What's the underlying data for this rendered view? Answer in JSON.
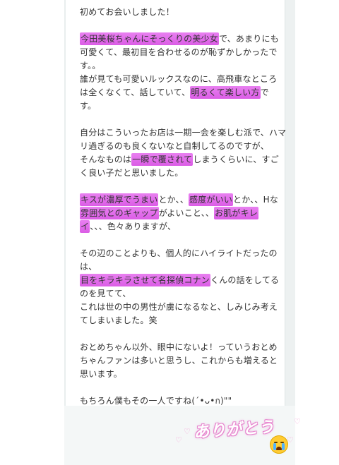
{
  "post": {
    "l01": "初めてお会いしました！",
    "l02_hl": "今田美桜ちゃんにそっくりの美少女",
    "l02_rest": "で、あまりにも",
    "l03": "可愛くて、最初目を合わせるのが恥ずかしかったで",
    "l04": "す。。",
    "l05": "誰が見ても可愛いルックスなのに、高飛車なところ",
    "l06_a": "は全くなくて、話していて、",
    "l06_hl": "明るくて楽しい方",
    "l06_b": "で",
    "l07": "す。",
    "l08": "自分はこういったお店は一期一会を楽しむ派で、ハマ",
    "l09": "リ過ぎるのも良くないなと自制してるのですが、",
    "l10_a": "そんなものは",
    "l10_hl": "一瞬で覆されて",
    "l10_b": "しまうくらいに、すご",
    "l11": "く良い子だと思いました。",
    "l12_hl1": "キスが濃厚でうまい",
    "l12_mid": "とか、、",
    "l12_hl2": "感度がいい",
    "l12_b": "とか、、Hな",
    "l13_hl": "雰囲気とのギャップ",
    "l13_mid": "がよいこと、、",
    "l13_hl2": "お肌がキレ",
    "l14_hl": "イ",
    "l14_b": "、、、色々ありますが、",
    "l15": "その辺のことよりも、個人的にハイライトだったの",
    "l16": "は、",
    "l17_hl": "目をキラキラさせて名探偵コナン",
    "l17_b": "くんの話をしてる",
    "l18": "のを見てて、",
    "l19": "これは世の中の男性が虜になるなと、しみじみ考え",
    "l20": "てしまいました。笑",
    "l21": "おとめちゃん以外、眼中にないよ！っていうおとめ",
    "l22": "ちゃんファンは多いと思うし、これからも増えると",
    "l23": "思います。",
    "l24": "もちろん僕もその一人ですね(´•ᴗ•ก)\"\""
  },
  "sticker": {
    "text": "ありがとう",
    "emoji": "crying-face-emoji"
  },
  "colors": {
    "highlight": "#dd55e8",
    "text": "#333333",
    "sticker_pink": "#ec93d6"
  }
}
